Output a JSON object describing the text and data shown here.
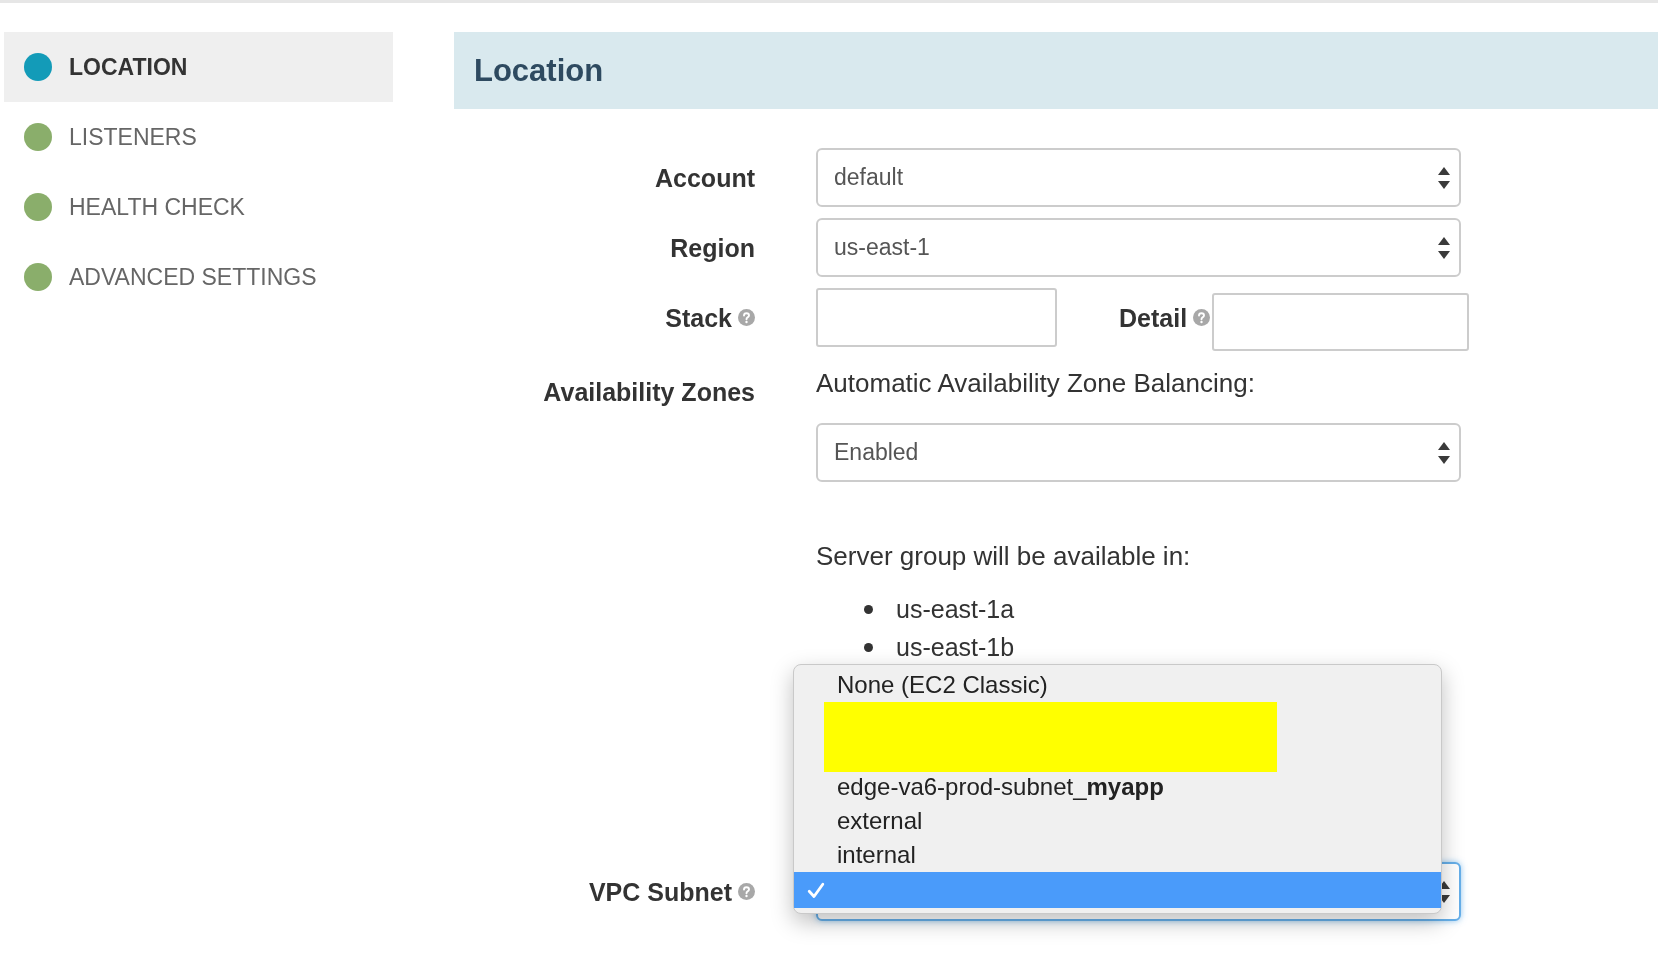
{
  "sidebar": {
    "items": [
      {
        "label": "LOCATION",
        "selected": true,
        "color": "#139bb8"
      },
      {
        "label": "LISTENERS",
        "selected": false,
        "color": "#8aae6b"
      },
      {
        "label": "HEALTH CHECK",
        "selected": false,
        "color": "#8aae6b"
      },
      {
        "label": "ADVANCED SETTINGS",
        "selected": false,
        "color": "#8aae6b"
      }
    ]
  },
  "section": {
    "title": "Location"
  },
  "form": {
    "account": {
      "label": "Account",
      "value": "default"
    },
    "region": {
      "label": "Region",
      "value": "us-east-1"
    },
    "stack": {
      "label": "Stack",
      "help": true
    },
    "detail": {
      "label": "Detail",
      "help": true
    },
    "availability_zones": {
      "label": "Availability Zones",
      "balancing_label": "Automatic Availability Zone Balancing:",
      "balancing_value": "Enabled",
      "available_in_label": "Server group will be available in:",
      "zones": [
        "us-east-1a",
        "us-east-1b"
      ]
    },
    "vpc_subnet": {
      "label": "VPC Subnet",
      "help": true,
      "focused": true,
      "open": true,
      "options": [
        {
          "kind": "option",
          "label": "None (EC2 Classic)",
          "selected": false
        },
        {
          "kind": "redacted",
          "selected": false
        },
        {
          "kind": "option",
          "label": "edge-va6-prod-subnet_**myapp**",
          "selected": false
        },
        {
          "kind": "option",
          "label": "external",
          "selected": false
        },
        {
          "kind": "option",
          "label": "internal",
          "selected": false
        },
        {
          "kind": "option",
          "selected": true
        }
      ]
    }
  }
}
